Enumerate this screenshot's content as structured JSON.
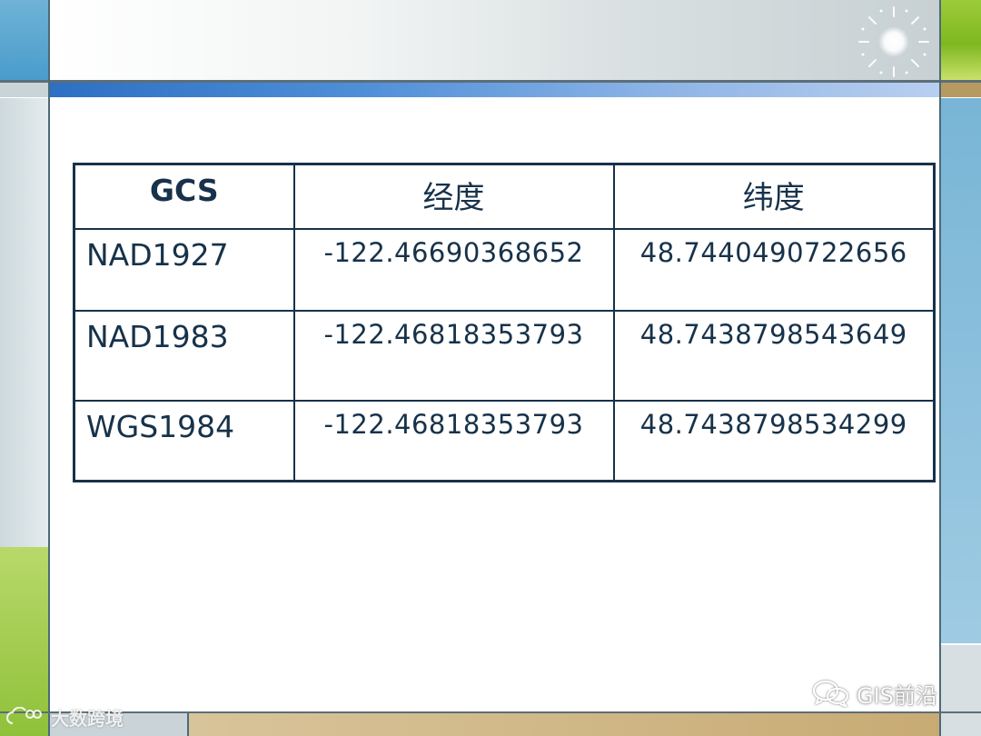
{
  "table": {
    "headers": [
      "GCS",
      "经度",
      "纬度"
    ],
    "rows": [
      {
        "gcs": "NAD1927",
        "longitude": "-122.46690368652",
        "latitude": "48.7440490722656"
      },
      {
        "gcs": "NAD1983",
        "longitude": "-122.46818353793",
        "latitude": "48.7438798543649"
      },
      {
        "gcs": "WGS1984",
        "longitude": "-122.46818353793",
        "latitude": "48.7438798534299"
      }
    ]
  },
  "watermarks": {
    "left": "大数跨境",
    "left_icon": "cloud-icon",
    "right": "GIS前沿",
    "right_icon": "wechat-icon"
  },
  "colors": {
    "table_border": "#17324a",
    "text": "#17324a",
    "accent_blue": "#2d6fc2",
    "accent_green": "#8fc13a"
  }
}
